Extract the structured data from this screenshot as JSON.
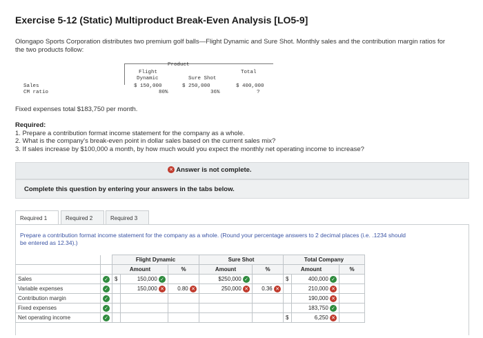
{
  "title": "Exercise 5-12 (Static) Multiproduct Break-Even Analysis [LO5-9]",
  "intro": "Olongapo Sports Corporation distributes two premium golf balls—Flight Dynamic and Sure Shot. Monthly sales and the contribution margin ratios for the two products follow:",
  "data_table": {
    "product_label": "Product",
    "flight_line1": "Flight",
    "flight_line2": "Dynamic",
    "sure_shot": "Sure Shot",
    "total": "Total",
    "sales_label": "Sales",
    "cm_label": "CM ratio",
    "flight_sales": "$ 150,000",
    "sure_sales": "$ 250,000",
    "total_sales": "$ 400,000",
    "flight_cm": "80%",
    "sure_cm": "36%",
    "total_cm": "?"
  },
  "fixed_expenses": "Fixed expenses total $183,750 per month.",
  "required": {
    "heading": "Required:",
    "items": [
      "1. Prepare a contribution format income statement for the company as a whole.",
      "2. What is the company's break-even point in dollar sales based on the current sales mix?",
      "3. If sales increase by $100,000 a month, by how much would you expect the monthly net operating income to increase?"
    ]
  },
  "answer_status": "Answer is not complete.",
  "complete_prompt": "Complete this question by entering your answers in the tabs below.",
  "tabs": [
    "Required 1",
    "Required 2",
    "Required 3"
  ],
  "instructions": "Prepare a contribution format income statement for the company as a whole. (Round your percentage answers to 2 decimal places (i.e. .1234 should be entered as 12.34).)",
  "statement": {
    "col_flight": "Flight Dynamic",
    "col_sure": "Sure Shot",
    "col_total": "Total Company",
    "amount": "Amount",
    "pct": "%",
    "rows": [
      {
        "label": "Sales",
        "fd_dollar": "$",
        "fd_amount": "150,000",
        "fd_pct": "",
        "ss_amount": "$250,000",
        "ss_pct": "",
        "tc_dollar": "$",
        "tc_amount": "400,000",
        "tc_pct": ""
      },
      {
        "label": "Variable expenses",
        "fd_dollar": "",
        "fd_amount": "150,000",
        "fd_pct": "0.80",
        "ss_amount": "250,000",
        "ss_pct": "0.36",
        "tc_dollar": "",
        "tc_amount": "210,000",
        "tc_pct": ""
      },
      {
        "label": "Contribution margin",
        "fd_dollar": "",
        "fd_amount": "",
        "fd_pct": "",
        "ss_amount": "",
        "ss_pct": "",
        "tc_dollar": "",
        "tc_amount": "190,000",
        "tc_pct": ""
      },
      {
        "label": "Fixed expenses",
        "fd_dollar": "",
        "fd_amount": "",
        "fd_pct": "",
        "ss_amount": "",
        "ss_pct": "",
        "tc_dollar": "",
        "tc_amount": "183,750",
        "tc_pct": ""
      },
      {
        "label": "Net operating income",
        "fd_dollar": "",
        "fd_amount": "",
        "fd_pct": "",
        "ss_amount": "",
        "ss_pct": "",
        "tc_dollar": "$",
        "tc_amount": "6,250",
        "tc_pct": ""
      }
    ]
  },
  "colors": {
    "correct": "#2e8b3d",
    "incorrect": "#c0392b",
    "link_blue": "#3b54a4"
  }
}
